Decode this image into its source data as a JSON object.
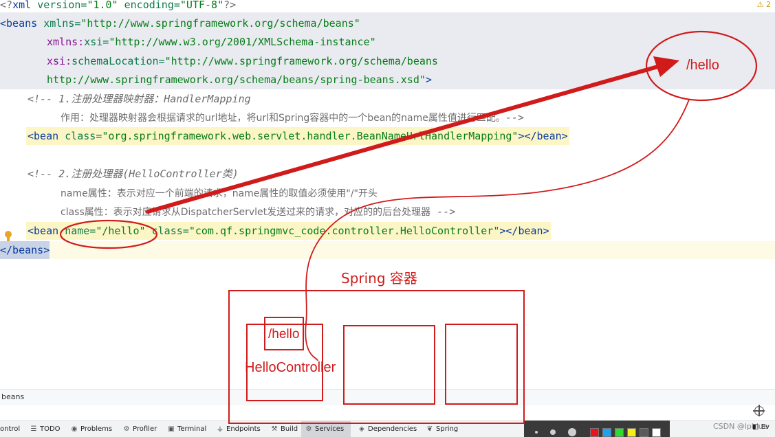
{
  "editor": {
    "warning_count": "2",
    "lines": {
      "l1": {
        "lt": "<?",
        "name": "xml ",
        "a1": "version=",
        "v1": "\"1.0\"",
        "a2": " encoding=",
        "v2": "\"UTF-8\"",
        "end": "?>"
      },
      "l2": {
        "lt": "<beans ",
        "attr": "xmlns=",
        "val": "\"http://www.springframework.org/schema/beans\""
      },
      "l3": {
        "prefix": "xmlns:",
        "attr": "xsi=",
        "val": "\"http://www.w3.org/2001/XMLSchema-instance\""
      },
      "l4": {
        "prefix": "xsi:",
        "attr": "schemaLocation=",
        "val": "\"http://www.springframework.org/schema/beans"
      },
      "l5": {
        "val": "http://www.springframework.org/schema/beans/spring-beans.xsd\"",
        "end": ">"
      },
      "l6": {
        "open": "<!-- ",
        "text": "1.注册处理器映射器：HandlerMapping"
      },
      "l7": {
        "text": "作用：处理器映射器会根据请求的url地址，将url和Spring容器中的一个bean的name属性值进行匹配。",
        "close": "-->"
      },
      "l8": {
        "open": "<bean ",
        "attr": "class=",
        "val": "\"org.springframework.web.servlet.handler.BeanNameUrlHandlerMapping\"",
        "end": "></bean>"
      },
      "l9": {
        "open": "<!-- ",
        "text": "2.注册处理器(HelloController类)"
      },
      "l10": {
        "text": "name属性：表示对应一个前端的请求，name属性的取值必须使用\"/\"开头"
      },
      "l11": {
        "text": "class属性：表示对应请求从DispatcherServlet发送过来的请求，对应的的后台处理器",
        "close": " -->"
      },
      "l12": {
        "open": "<bean ",
        "a1": "name=",
        "v1": "\"/hello\"",
        "a2": " class=",
        "v2": "\"com.qf.springmvc_code.controller.HelloController\"",
        "end": "></bean>"
      },
      "l13": {
        "close": "</beans>"
      }
    }
  },
  "breadcrumb": {
    "path": "beans"
  },
  "toolbar": {
    "items": [
      "ontrol",
      "TODO",
      "Problems",
      "Profiler",
      "Terminal",
      "Endpoints",
      "Build",
      "Services",
      "Dependencies",
      "Spring"
    ],
    "active": "Services",
    "ev_tab": "Ev"
  },
  "annotation": {
    "hello_bubble": "/hello",
    "container_title": "Spring 容器",
    "inner_hello": "/hello",
    "controller_label": "HelloController",
    "color": "#d11a1a"
  },
  "drawing_palette": {
    "swatches": [
      "#e8141c",
      "#1da1f2",
      "#2bdc2b",
      "#f6ee1b",
      "#5a5a5a",
      "#ffffff"
    ]
  },
  "watermark": "CSDN @lpblue"
}
